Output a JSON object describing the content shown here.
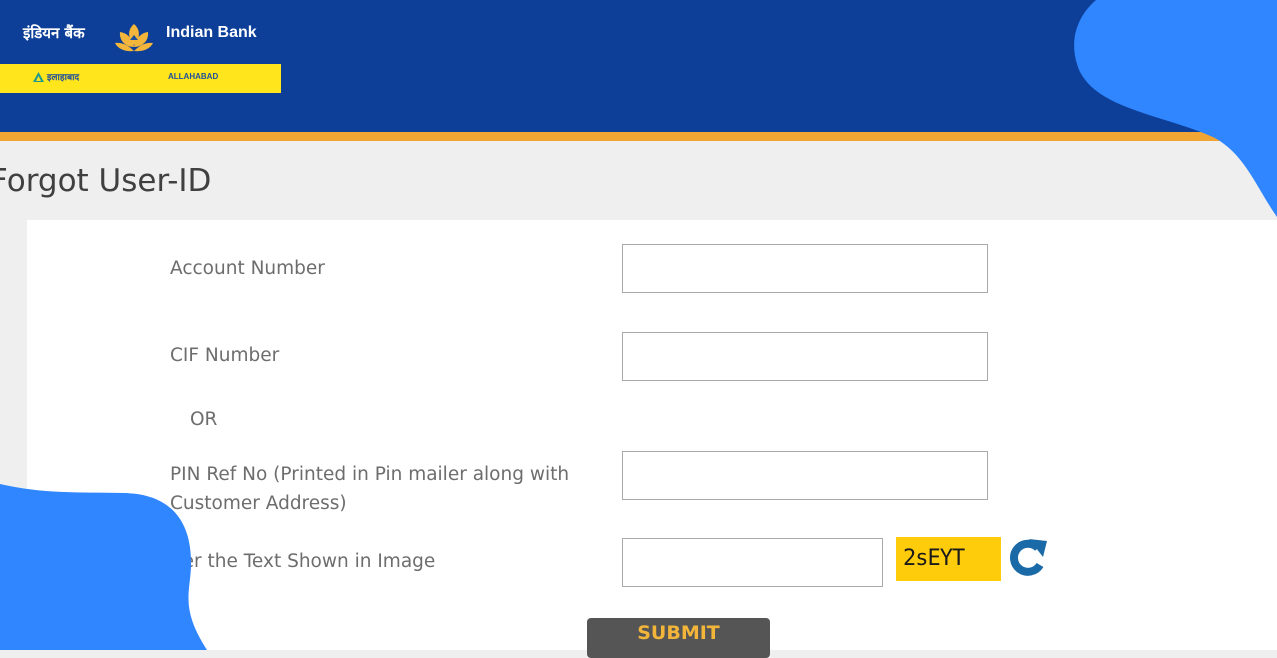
{
  "header": {
    "bank_name_hindi": "इंडियन बैंक",
    "bank_name_english": "Indian Bank",
    "merged_bank_hindi": "इलाहाबाद",
    "merged_bank_english": "ALLAHABAD",
    "emblem_icon": "lotus-emblem-icon",
    "colors": {
      "header_bg": "#0d3f98",
      "stripe": "#f0a534",
      "band": "#ffe51c",
      "emblem": "#f4b63a"
    }
  },
  "page": {
    "title": "Forgot User-ID"
  },
  "form": {
    "account_number_label": "Account Number",
    "account_number_value": "",
    "cif_number_label": "CIF Number",
    "cif_number_value": "",
    "or_label": "OR",
    "pin_ref_label_line1": "PIN Ref No (Printed in Pin mailer along with",
    "pin_ref_label_line2": "Customer Address)",
    "pin_ref_value": "",
    "captcha_label": "Enter the Text Shown in Image",
    "captcha_value": "",
    "captcha_text": "2sEYT",
    "refresh_icon": "refresh-icon",
    "submit_label": "SUBMIT"
  },
  "decor": {
    "blob_color": "#2f86ff"
  }
}
